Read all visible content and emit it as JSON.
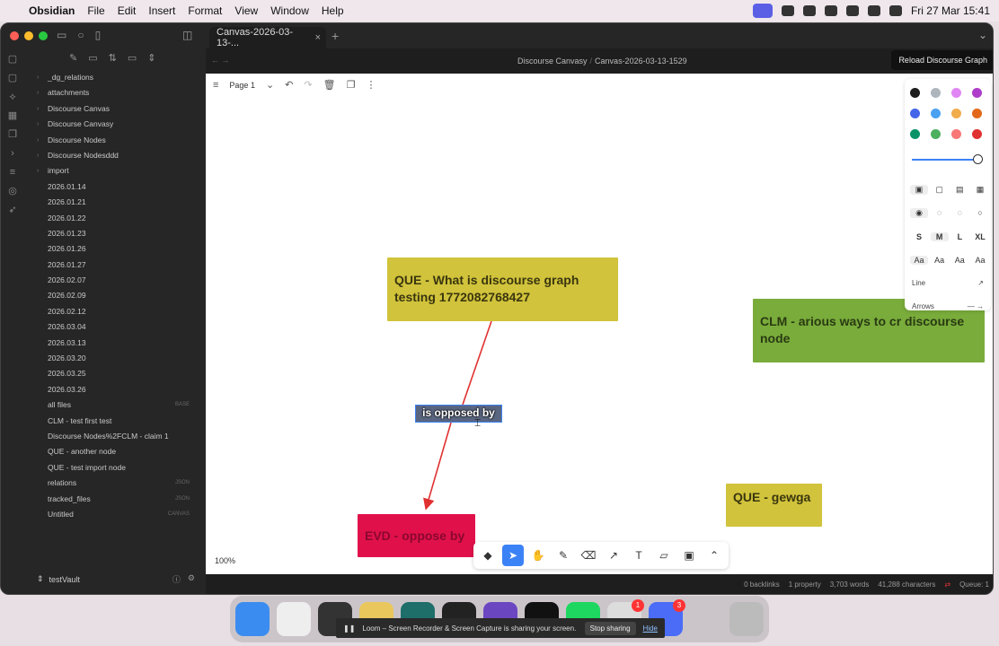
{
  "menubar": {
    "app": "Obsidian",
    "items": [
      "File",
      "Edit",
      "Insert",
      "Format",
      "View",
      "Window",
      "Help"
    ],
    "clock": "Fri 27 Mar  15:41"
  },
  "tab": {
    "title": "Canvas-2026-03-13-...",
    "close": "×",
    "new": "+"
  },
  "header": {
    "breadcrumb_parent": "Discourse Canvasy",
    "breadcrumb_current": "Canvas-2026-03-13-1529",
    "reload_button": "Reload Discourse Graph"
  },
  "sidebar": {
    "items": [
      {
        "label": "_dg_relations",
        "folder": true,
        "ext": ""
      },
      {
        "label": "attachments",
        "folder": true,
        "ext": ""
      },
      {
        "label": "Discourse Canvas",
        "folder": true,
        "ext": ""
      },
      {
        "label": "Discourse Canvasy",
        "folder": true,
        "ext": ""
      },
      {
        "label": "Discourse Nodes",
        "folder": true,
        "ext": ""
      },
      {
        "label": "Discourse Nodesddd",
        "folder": true,
        "ext": ""
      },
      {
        "label": "import",
        "folder": true,
        "ext": ""
      },
      {
        "label": "2026.01.14",
        "folder": false,
        "ext": ""
      },
      {
        "label": "2026.01.21",
        "folder": false,
        "ext": ""
      },
      {
        "label": "2026.01.22",
        "folder": false,
        "ext": ""
      },
      {
        "label": "2026.01.23",
        "folder": false,
        "ext": ""
      },
      {
        "label": "2026.01.26",
        "folder": false,
        "ext": ""
      },
      {
        "label": "2026.01.27",
        "folder": false,
        "ext": ""
      },
      {
        "label": "2026.02.07",
        "folder": false,
        "ext": ""
      },
      {
        "label": "2026.02.09",
        "folder": false,
        "ext": ""
      },
      {
        "label": "2026.02.12",
        "folder": false,
        "ext": ""
      },
      {
        "label": "2026.03.04",
        "folder": false,
        "ext": ""
      },
      {
        "label": "2026.03.13",
        "folder": false,
        "ext": ""
      },
      {
        "label": "2026.03.20",
        "folder": false,
        "ext": ""
      },
      {
        "label": "2026.03.25",
        "folder": false,
        "ext": ""
      },
      {
        "label": "2026.03.26",
        "folder": false,
        "ext": ""
      },
      {
        "label": "all files",
        "folder": false,
        "ext": "BASE"
      },
      {
        "label": "CLM - test first test",
        "folder": false,
        "ext": ""
      },
      {
        "label": "Discourse Nodes%2FCLM - claim 1",
        "folder": false,
        "ext": ""
      },
      {
        "label": "QUE - another node",
        "folder": false,
        "ext": ""
      },
      {
        "label": "QUE - test import node",
        "folder": false,
        "ext": ""
      },
      {
        "label": "relations",
        "folder": false,
        "ext": "JSON"
      },
      {
        "label": "tracked_files",
        "folder": false,
        "ext": "JSON"
      },
      {
        "label": "Untitled",
        "folder": false,
        "ext": "CANVAS"
      }
    ],
    "vault": "testVault"
  },
  "canvas": {
    "page": "Page 1",
    "zoom": "100%",
    "nodes": {
      "que_main": "QUE - What is discourse graph testing 1772082768427",
      "clm": "CLM - arious ways to cr discourse node",
      "que_small": "QUE - gewga",
      "evd": "EVD - oppose by"
    },
    "edge_label": "is opposed by"
  },
  "style_panel": {
    "colors": [
      "#1d1d1d",
      "#adb5bd",
      "#e085f4",
      "#ae3ec9",
      "#4465e9",
      "#4ba1f1",
      "#f1ac4b",
      "#e16919",
      "#099268",
      "#4cb05e",
      "#f87777",
      "#e03131"
    ],
    "size_labels": [
      "S",
      "M",
      "L",
      "XL"
    ],
    "font_labels": [
      "Aa",
      "Aa",
      "Aa",
      "Aa"
    ],
    "line_label": "Line",
    "arrows_label": "Arrows"
  },
  "status": {
    "backlinks": "0 backlinks",
    "properties": "1 property",
    "words": "3,703 words",
    "chars": "41,288 characters",
    "queue": "Queue: 1"
  },
  "share": {
    "text": "Loom – Screen Recorder & Screen Capture is sharing your screen.",
    "stop": "Stop sharing",
    "hide": "Hide"
  },
  "dock": {
    "badges": [
      "1",
      "3"
    ]
  }
}
